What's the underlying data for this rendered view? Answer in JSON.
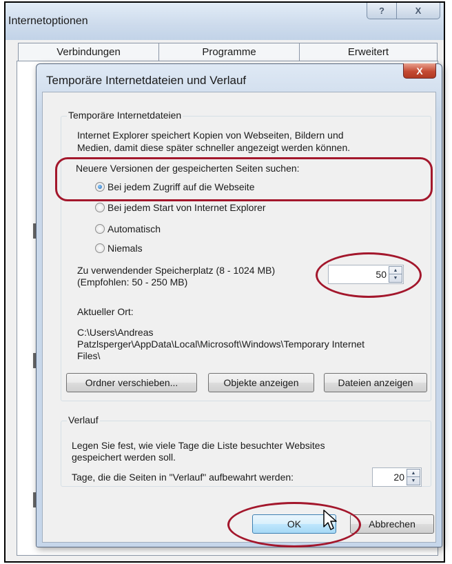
{
  "outer_window": {
    "title": "Internetoptionen",
    "help_button": "?",
    "close_button": "X",
    "tabs": [
      "Verbindungen",
      "Programme",
      "Erweitert"
    ]
  },
  "dialog": {
    "title": "Temporäre Internetdateien und Verlauf",
    "close_button": "X",
    "temp_files": {
      "group_label": "Temporäre Internetdateien",
      "description_line1": "Internet Explorer speichert Kopien von Webseiten, Bildern und",
      "description_line2": "Medien, damit diese später schneller angezeigt werden können.",
      "check_label": "Neuere Versionen der gespeicherten Seiten suchen:",
      "options": [
        {
          "label": "Bei jedem Zugriff auf die Webseite",
          "checked": true
        },
        {
          "label": "Bei jedem Start von Internet Explorer",
          "checked": false
        },
        {
          "label": "Automatisch",
          "checked": false
        },
        {
          "label": "Niemals",
          "checked": false
        }
      ],
      "disk_space_label_line1": "Zu verwendender Speicherplatz (8 - 1024 MB)",
      "disk_space_label_line2": "(Empfohlen: 50 - 250 MB)",
      "disk_space_value": "50",
      "location_label": "Aktueller Ort:",
      "location_path_line1": "C:\\Users\\Andreas",
      "location_path_line2": "Patzlsperger\\AppData\\Local\\Microsoft\\Windows\\Temporary Internet",
      "location_path_line3": "Files\\",
      "buttons": {
        "move_folder": "Ordner verschieben...",
        "view_objects": "Objekte anzeigen",
        "view_files": "Dateien anzeigen"
      }
    },
    "history": {
      "group_label": "Verlauf",
      "description_line1": "Legen Sie fest, wie viele Tage die Liste besuchter Websites",
      "description_line2": "gespeichert werden soll.",
      "days_label": "Tage, die die Seiten in \"Verlauf\" aufbewahrt werden:",
      "days_value": "20"
    },
    "ok_button": "OK",
    "cancel_button": "Abbrechen"
  },
  "colors": {
    "highlight": "#a3172c",
    "close_red": "#c44a33",
    "title_blue": "#cddbec"
  }
}
